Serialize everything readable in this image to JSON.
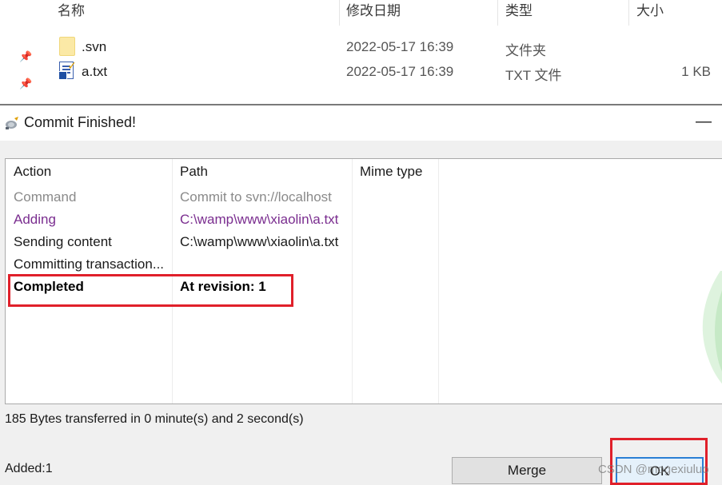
{
  "explorer": {
    "columns": {
      "name": "名称",
      "date": "修改日期",
      "type": "类型",
      "size": "大小"
    },
    "files": [
      {
        "name": ".svn",
        "date": "2022-05-17 16:39",
        "type": "文件夹",
        "size": "",
        "icon": "folder-icon"
      },
      {
        "name": "a.txt",
        "date": "2022-05-17 16:39",
        "type": "TXT 文件",
        "size": "1 KB",
        "icon": "svn-txt-file-icon"
      }
    ]
  },
  "dialog": {
    "title": "Commit Finished!",
    "minimize_glyph": "—",
    "table": {
      "headers": {
        "action": "Action",
        "path": "Path",
        "mime": "Mime type"
      },
      "rows": [
        {
          "action": "Command",
          "path": "Commit to svn://localhost",
          "style": "command"
        },
        {
          "action": "Adding",
          "path": "C:\\wamp\\www\\xiaolin\\a.txt",
          "style": "adding"
        },
        {
          "action": "Sending content",
          "path": "C:\\wamp\\www\\xiaolin\\a.txt",
          "style": "sending"
        },
        {
          "action": "Committing transaction...",
          "path": "",
          "style": "committing"
        },
        {
          "action": "Completed",
          "path": "At revision: 1",
          "style": "completed"
        }
      ]
    },
    "status": "185 Bytes transferred in 0 minute(s) and 2 second(s)",
    "added": "Added:1",
    "buttons": {
      "merge": "Merge",
      "ok": "OK"
    },
    "watermark": "CSDN @mogexiuluo"
  },
  "colors": {
    "adding": "#7a2d8f",
    "command": "#8a8a8a",
    "highlight_box": "#e0202a",
    "ok_focus": "#2b7fd4"
  }
}
